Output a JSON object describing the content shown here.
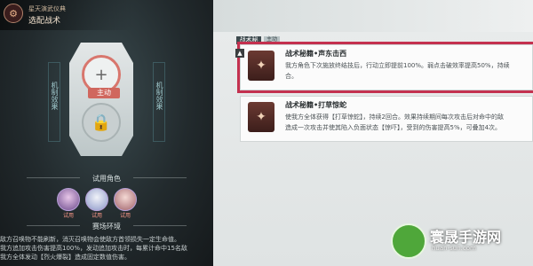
{
  "header": {
    "subtitle": "星天演武仪典",
    "title": "选配战术",
    "badge": "⚙"
  },
  "slots": {
    "left_vertical": "机制效果",
    "right_vertical": "机制效果",
    "active_tag": "主动"
  },
  "trial": {
    "title": "试用角色",
    "avatars": [
      {
        "tag": "试用"
      },
      {
        "tag": "试用"
      },
      {
        "tag": "试用"
      }
    ]
  },
  "env": {
    "title": "赛场环境",
    "lines": [
      "敌方召唤物不能刷新，消灭召唤物会使敌方首领损失一定生命值。",
      "我方追加攻击伤害提高100%，发动追加攻击时，每累计命中15名敌",
      "我方全体发动【烈火爆裂】造成固定数值伤害。"
    ]
  },
  "panel": {
    "section_title": "战术秘籍",
    "section_pill": "主动"
  },
  "cards": [
    {
      "name": "战术秘籍•声东击西",
      "thumb": "▲",
      "desc1": "我方角色下次施放终结技后，行动立即提前100%。弱点击破效率提高50%，持续",
      "desc2": "合。",
      "selected": true
    },
    {
      "name": "战术秘籍•打草惊蛇",
      "thumb": "",
      "desc1": "使我方全体获得【打草惊蛇】，持续2回合。效果持续期间每次攻击后对命中的敌",
      "desc2": "造成一次攻击并使其陷入负面状态【惊吓】，受到的伤害提高5%，可叠加4次。",
      "selected": false
    }
  ],
  "watermark": {
    "name": "寰晟手游网",
    "url": "huan-sun.com"
  },
  "colors": {
    "selected_outline": "#c4314f",
    "accent_orange": "#e07a2c",
    "active_slot": "#d0675e"
  }
}
